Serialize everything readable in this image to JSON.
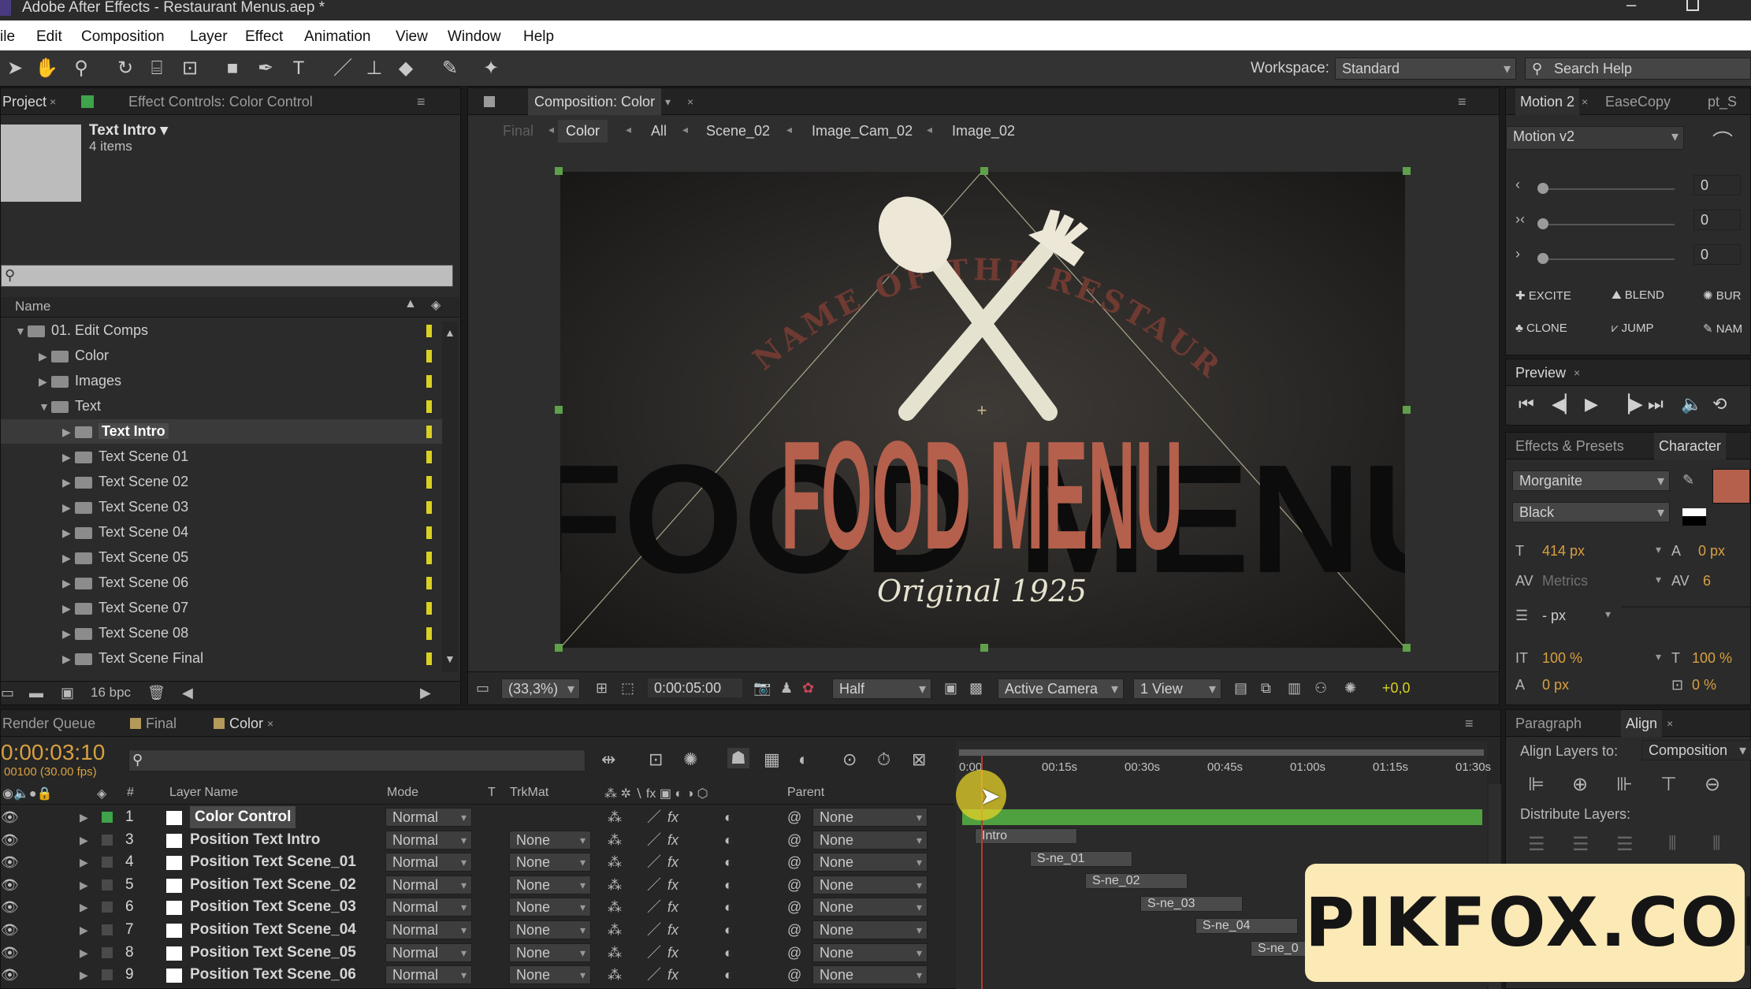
{
  "window": {
    "title": "Adobe After Effects - Restaurant Menus.aep *"
  },
  "menu": [
    "ile",
    "Edit",
    "Composition",
    "Layer",
    "Effect",
    "Animation",
    "View",
    "Window",
    "Help"
  ],
  "toolbar": {
    "workspace_label": "Workspace:",
    "workspace_value": "Standard",
    "search_placeholder": "Search Help"
  },
  "project": {
    "tab_project": "Project",
    "tab_effects": "Effect Controls: Color Control",
    "selected_name": "Text Intro ▾",
    "selected_count": "4 items",
    "col_name": "Name",
    "tree": [
      {
        "label": "01. Edit Comps",
        "indent": 0,
        "open": true
      },
      {
        "label": "Color",
        "indent": 1,
        "open": false
      },
      {
        "label": "Images",
        "indent": 1,
        "open": false
      },
      {
        "label": "Text",
        "indent": 1,
        "open": true
      },
      {
        "label": "Text Intro",
        "indent": 2,
        "open": false,
        "selected": true
      },
      {
        "label": "Text Scene 01",
        "indent": 2,
        "open": false
      },
      {
        "label": "Text Scene 02",
        "indent": 2,
        "open": false
      },
      {
        "label": "Text Scene 03",
        "indent": 2,
        "open": false
      },
      {
        "label": "Text Scene 04",
        "indent": 2,
        "open": false
      },
      {
        "label": "Text Scene 05",
        "indent": 2,
        "open": false
      },
      {
        "label": "Text Scene 06",
        "indent": 2,
        "open": false
      },
      {
        "label": "Text Scene 07",
        "indent": 2,
        "open": false
      },
      {
        "label": "Text Scene 08",
        "indent": 2,
        "open": false
      },
      {
        "label": "Text Scene Final",
        "indent": 2,
        "open": false
      }
    ],
    "bpc": "16 bpc"
  },
  "comp": {
    "tab": "Composition: Color",
    "breadcrumbs": [
      "Final",
      "Color",
      "All",
      "Scene_02",
      "Image_Cam_02",
      "Image_02"
    ],
    "arc_text": "THE NAME OF THE RESTAURANT",
    "headline": "FOOD MENU",
    "sub": "Original 1925",
    "zoom": "(33,3%)",
    "timecode": "0:00:05:00",
    "resolution": "Half",
    "camera": "Active Camera",
    "views": "1 View",
    "exposure": "+0,0"
  },
  "motion": {
    "tabs": [
      "Motion 2",
      "EaseCopy",
      "pt_S"
    ],
    "preset": "Motion v2",
    "values": [
      "0",
      "0",
      "0"
    ],
    "buttons": [
      "EXCITE",
      "BLEND",
      "BUR",
      "CLONE",
      "JUMP",
      "NAM"
    ]
  },
  "preview": {
    "tab": "Preview"
  },
  "character": {
    "tab_effects": "Effects & Presets",
    "tab_char": "Character",
    "font": "Morganite",
    "style": "Black",
    "size": "414 px",
    "leading": "0 px",
    "kerning": "Metrics",
    "tracking": "6",
    "stroke": "- px",
    "vscale": "100 %",
    "hscale": "100 %",
    "baseline": "0 px",
    "tsume": "0 %",
    "color_fill": "#b4604c"
  },
  "align": {
    "tab_para": "Paragraph",
    "tab_align": "Align",
    "align_to_label": "Align Layers to:",
    "align_to_value": "Composition",
    "distribute": "Distribute Layers:"
  },
  "timeline": {
    "tabs": [
      "Render Queue",
      "Final",
      "Color"
    ],
    "timecode": "0:00:03:10",
    "frames": "00100 (30.00 fps)",
    "col_num": "#",
    "col_name": "Layer Name",
    "col_mode": "Mode",
    "col_t": "T",
    "col_trk": "TrkMat",
    "col_parent": "Parent",
    "ruler": [
      "0:00",
      "00:15s",
      "00:30s",
      "00:45s",
      "01:00s",
      "01:15s",
      "01:30s"
    ],
    "layers": [
      {
        "num": "1",
        "name": "Color Control",
        "mode": "Normal",
        "trk": "",
        "parent": "None",
        "selected": true
      },
      {
        "num": "3",
        "name": "Position Text Intro",
        "mode": "Normal",
        "trk": "None",
        "parent": "None",
        "bar": "Intro"
      },
      {
        "num": "4",
        "name": "Position Text Scene_01",
        "mode": "Normal",
        "trk": "None",
        "parent": "None",
        "bar": "S-ne_01"
      },
      {
        "num": "5",
        "name": "Position Text Scene_02",
        "mode": "Normal",
        "trk": "None",
        "parent": "None",
        "bar": "S-ne_02"
      },
      {
        "num": "6",
        "name": "Position Text Scene_03",
        "mode": "Normal",
        "trk": "None",
        "parent": "None",
        "bar": "S-ne_03"
      },
      {
        "num": "7",
        "name": "Position Text Scene_04",
        "mode": "Normal",
        "trk": "None",
        "parent": "None",
        "bar": "S-ne_04"
      },
      {
        "num": "8",
        "name": "Position Text Scene_05",
        "mode": "Normal",
        "trk": "None",
        "parent": "None",
        "bar": "S-ne_0"
      },
      {
        "num": "9",
        "name": "Position Text Scene_06",
        "mode": "Normal",
        "trk": "None",
        "parent": "None",
        "bar": ""
      }
    ]
  },
  "watermark": "PIKFOX.COM"
}
